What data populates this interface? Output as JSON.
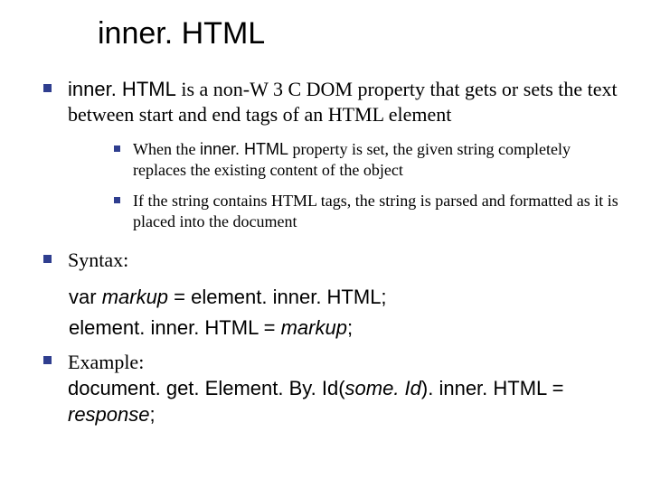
{
  "title": "inner. HTML",
  "bullets": {
    "b1": {
      "prefix": "inner. HTML",
      "rest": " is a non-W 3 C DOM property that gets or sets the text between start and end tags of an HTML element"
    },
    "b1_sub": {
      "s1": {
        "pre": "When the ",
        "code": "inner. HTML",
        "post": " property is set, the given string completely replaces the existing content of the object"
      },
      "s2": "If the string contains HTML tags, the string is parsed and formatted as it is placed into the document"
    },
    "b2_label": "Syntax:",
    "syntax": {
      "line1_pre": "var ",
      "line1_var": "markup",
      "line1_post": " = element. inner. HTML;",
      "line2_pre": "element. inner. HTML = ",
      "line2_var": "markup",
      "line2_post": ";"
    },
    "b3_label": "Example:",
    "example": {
      "pre": "document. get. Element. By. Id(",
      "arg": "some. Id",
      "mid": "). inner. HTML = ",
      "resp": "response",
      "post": ";"
    }
  }
}
